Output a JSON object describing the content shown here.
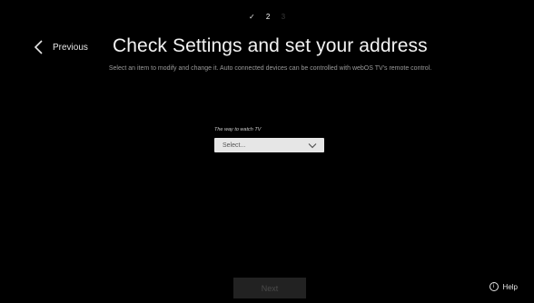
{
  "steps": {
    "done": "✓",
    "current": "2",
    "future": "3"
  },
  "header": {
    "previous_label": "Previous",
    "title": "Check Settings and set your address",
    "subtitle": "Select an item to modify and change it. Auto connected devices can be controlled with webOS TV's remote control."
  },
  "form": {
    "label": "The way to watch TV",
    "select_value": "Select..."
  },
  "footer": {
    "next_label": "Next",
    "help_label": "Help",
    "help_icon_glyph": "i"
  },
  "icons": {
    "previous": "chevron-left-icon",
    "select": "chevron-down-icon",
    "help": "info-icon"
  },
  "colors": {
    "background": "#000000",
    "select_background": "#e6e6e6",
    "next_disabled_background": "#222222",
    "next_disabled_text": "#4a4a4a"
  }
}
